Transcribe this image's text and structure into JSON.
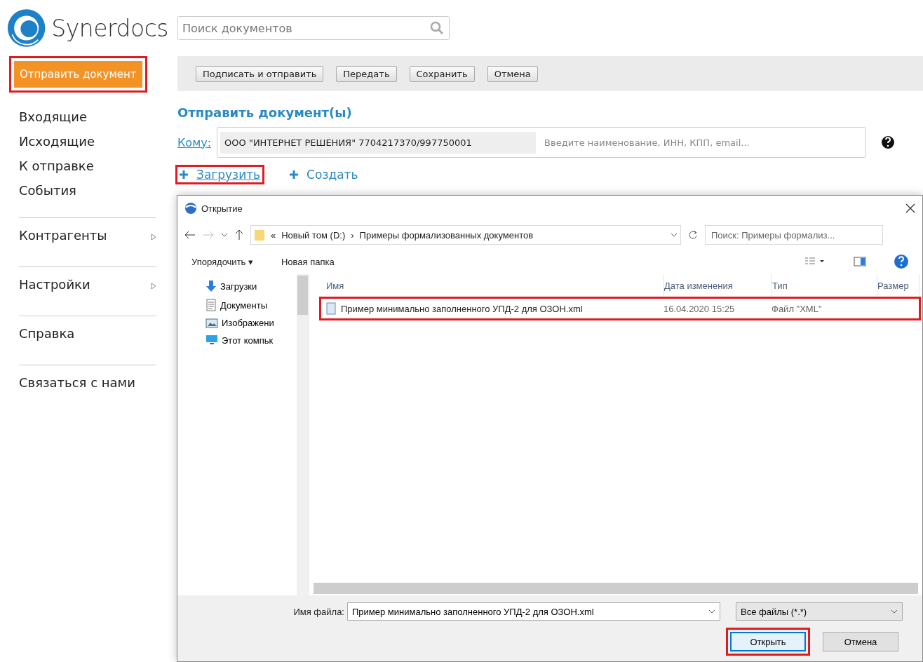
{
  "logo": {
    "text": "Synerdocs"
  },
  "search": {
    "placeholder": "Поиск документов"
  },
  "send_button": {
    "label": "Отправить документ",
    "highlighted": true
  },
  "sidebar": {
    "items": [
      {
        "label": "Входящие",
        "has_submenu": false,
        "divider_before": false
      },
      {
        "label": "Исходящие",
        "has_submenu": false,
        "divider_before": false
      },
      {
        "label": "К отправке",
        "has_submenu": false,
        "divider_before": false
      },
      {
        "label": "События",
        "has_submenu": false,
        "divider_before": false
      },
      {
        "label": "Контрагенты",
        "has_submenu": true,
        "divider_before": true
      },
      {
        "label": "Настройки",
        "has_submenu": true,
        "divider_before": true
      },
      {
        "label": "Справка",
        "has_submenu": false,
        "divider_before": true
      },
      {
        "label": "Связаться с нами",
        "has_submenu": false,
        "divider_before": true
      }
    ]
  },
  "toolbar": {
    "buttons": [
      "Подписать и отправить",
      "Передать",
      "Сохранить",
      "Отмена"
    ]
  },
  "form": {
    "title": "Отправить документ(ы)",
    "recipient_label": "Кому:",
    "recipient": "ООО \"ИНТЕРНЕТ РЕШЕНИЯ\" 7704217370/997750001",
    "recipient_placeholder": "Введите наименование, ИНН, КПП, email...",
    "actions": [
      {
        "label": "Загрузить",
        "highlighted": true
      },
      {
        "label": "Создать",
        "highlighted": false
      }
    ]
  },
  "dialog": {
    "title": "Открытие",
    "path": [
      "«",
      "Новый том (D:)",
      "›",
      "Примеры формализованных документов"
    ],
    "search_placeholder": "Поиск: Примеры формализ...",
    "commands": [
      "Упорядочить ▾",
      "Новая папка"
    ],
    "nav_items": [
      {
        "label": "Загрузки",
        "kind": "downloads"
      },
      {
        "label": "Документы",
        "kind": "documents"
      },
      {
        "label": "Изображени",
        "kind": "pictures"
      },
      {
        "label": "Этот компьк",
        "kind": "computer"
      }
    ],
    "columns": [
      "Имя",
      "Дата изменения",
      "Тип",
      "Размер"
    ],
    "files": [
      {
        "name": "Пример минимально заполненного УПД-2 для ОЗОН.xml",
        "modified": "16.04.2020 15:25",
        "type": "Файл \"XML\"",
        "highlighted": true
      }
    ],
    "filename_label": "Имя файла:",
    "filename": "Пример минимально заполненного УПД-2 для ОЗОН.xml",
    "filter": "Все файлы (*.*)",
    "buttons": [
      {
        "label": "Открыть",
        "primary": true,
        "highlighted": true
      },
      {
        "label": "Отмена",
        "primary": false,
        "highlighted": false
      }
    ]
  }
}
